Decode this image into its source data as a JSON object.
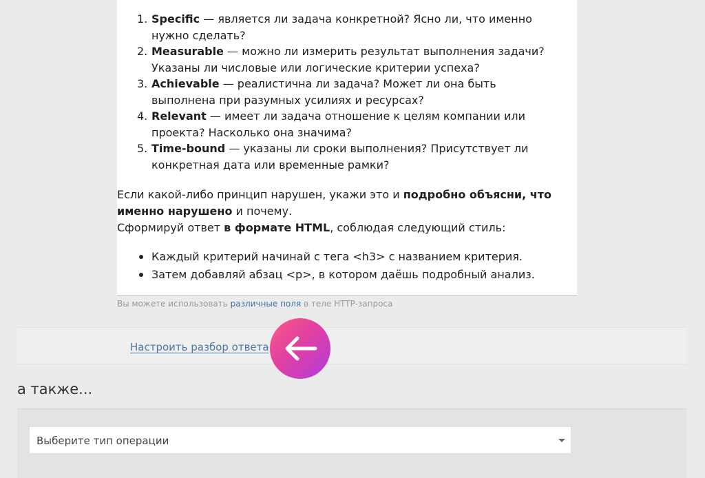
{
  "criteria": [
    {
      "num": "1.",
      "title": "Specific",
      "text": " — является ли задача конкретной? Ясно ли, что именно нужно сделать?"
    },
    {
      "num": "2.",
      "title": "Measurable",
      "text": " — можно ли измерить результат выполнения задачи? Указаны ли числовые или логические критерии успеха?"
    },
    {
      "num": "3.",
      "title": "Achievable",
      "text": " — реалистична ли задача? Может ли она быть выполнена при разумных усилиях и ресурсах?"
    },
    {
      "num": "4.",
      "title": "Relevant",
      "text": " — имеет ли задача отношение к целям компании или проекта? Насколько она значима?"
    },
    {
      "num": "5.",
      "title": "Time-bound",
      "text": " — указаны ли сроки выполнения? Присутствует ли конкретная дата или временные рамки?"
    }
  ],
  "paragraph": {
    "part1": "Если какой-либо принцип нарушен, укажи это и ",
    "bold1": "подробно объясни, что именно нарушено",
    "part2": " и почему.",
    "part3": "Сформируй ответ ",
    "bold2": "в формате HTML",
    "part4": ", соблюдая следующий стиль:"
  },
  "style_rules": [
    "Каждый критерий начинай с тега <h3> с названием критерия.",
    "Затем добавляй абзац <p>, в котором даёшь подробный анализ."
  ],
  "hint": {
    "before": "Вы можете использовать ",
    "link": "различные поля",
    "after": " в теле HTTP-запроса"
  },
  "config_link": "Настроить разбор ответа",
  "also_heading": "а также...",
  "operation_select": {
    "value": "Выберите тип операции"
  },
  "colors": {
    "badge_start": "#ff5a8a",
    "badge_end": "#b43be0",
    "link": "#4d76a6"
  }
}
